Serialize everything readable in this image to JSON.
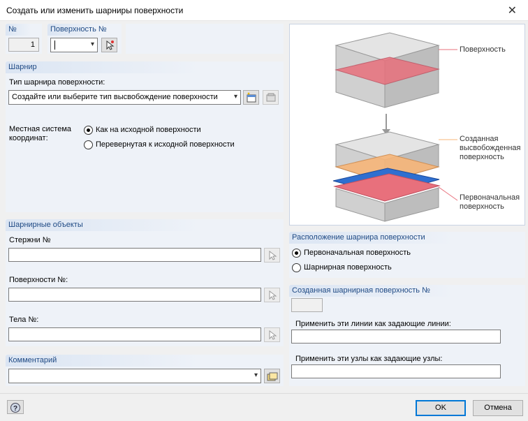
{
  "window": {
    "title": "Создать или изменить шарниры поверхности",
    "close_glyph": "✕"
  },
  "top": {
    "no_header": "№",
    "no_value": "1",
    "surface_header": "Поверхность №",
    "surface_value": ""
  },
  "hinge": {
    "header": "Шарнир",
    "type_label": "Тип шарнира поверхности:",
    "type_value": "Создайте или выберите тип высвобождение поверхности",
    "coord_label_1": "Местная система",
    "coord_label_2": "координат:",
    "coord_options": [
      {
        "label": "Как на исходной поверхности",
        "selected": true
      },
      {
        "label": "Перевернутая к исходной поверхности",
        "selected": false
      }
    ]
  },
  "objects": {
    "header": "Шарнирные объекты",
    "members_label": "Стержни №",
    "surfaces_label": "Поверхности №:",
    "solids_label": "Тела №:",
    "members_value": "",
    "surfaces_value": "",
    "solids_value": ""
  },
  "comment": {
    "header": "Комментарий",
    "value": ""
  },
  "figure": {
    "label_surface": "Поверхность",
    "label_created_1": "Созданная",
    "label_created_2": "высвобожденная",
    "label_created_3": "поверхность",
    "label_original_1": "Первоначальная",
    "label_original_2": "поверхность"
  },
  "location": {
    "header": "Расположение шарнира поверхности",
    "options": [
      {
        "label": "Первоначальная поверхность",
        "selected": true
      },
      {
        "label": "Шарнирная поверхность",
        "selected": false
      }
    ]
  },
  "created": {
    "header": "Созданная шарнирная поверхность №",
    "number_value": "",
    "lines_label": "Применить эти линии как задающие линии:",
    "lines_value": "",
    "nodes_label": "Применить эти узлы как задающие узлы:",
    "nodes_value": ""
  },
  "footer": {
    "ok_label": "OK",
    "cancel_label": "Отмена"
  },
  "colors": {
    "accent": "#0078d7",
    "section_header_text": "#1f4a84",
    "surface_red": "#e8707c",
    "released_orange": "#f7b679",
    "hinge_blue": "#2f6fd0"
  },
  "icons": [
    "close-icon",
    "pick-cursor-icon",
    "new-item-icon",
    "library-icon",
    "help-icon"
  ]
}
